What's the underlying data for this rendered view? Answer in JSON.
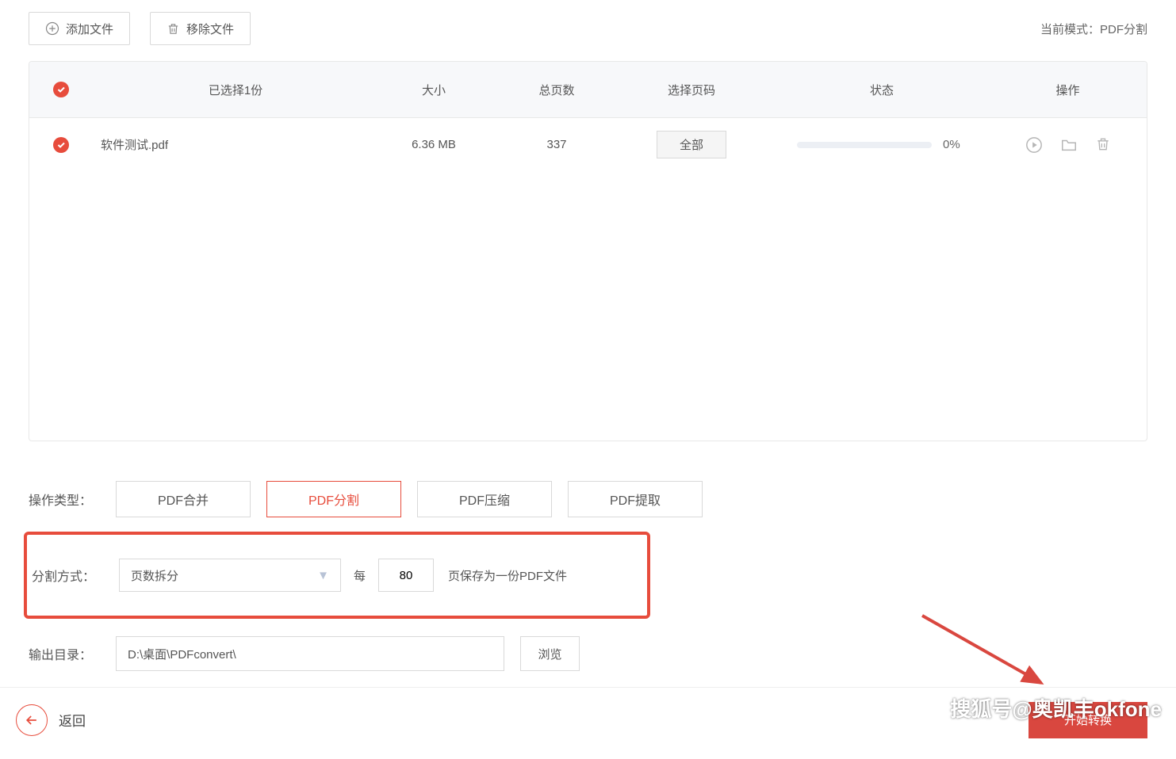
{
  "toolbar": {
    "add_file": "添加文件",
    "remove_file": "移除文件"
  },
  "mode": {
    "label": "当前模式：",
    "value": "PDF分割"
  },
  "table": {
    "header": {
      "selected": "已选择1份",
      "size": "大小",
      "pages": "总页数",
      "pick_pages": "选择页码",
      "status": "状态",
      "actions": "操作"
    },
    "rows": [
      {
        "name": "软件测试.pdf",
        "size": "6.36 MB",
        "pages": "337",
        "pick": "全部",
        "percent": "0%"
      }
    ]
  },
  "ops": {
    "label": "操作类型：",
    "buttons": [
      "PDF合并",
      "PDF分割",
      "PDF压缩",
      "PDF提取"
    ],
    "active_index": 1
  },
  "split": {
    "label": "分割方式：",
    "method": "页数拆分",
    "prefix": "每",
    "value": "80",
    "suffix": "页保存为一份PDF文件"
  },
  "output": {
    "label": "输出目录：",
    "path": "D:\\桌面\\PDFconvert\\",
    "browse": "浏览"
  },
  "footer": {
    "back": "返回",
    "start": "开始转换"
  },
  "watermark": "搜狐号@奥凯丰okfone"
}
